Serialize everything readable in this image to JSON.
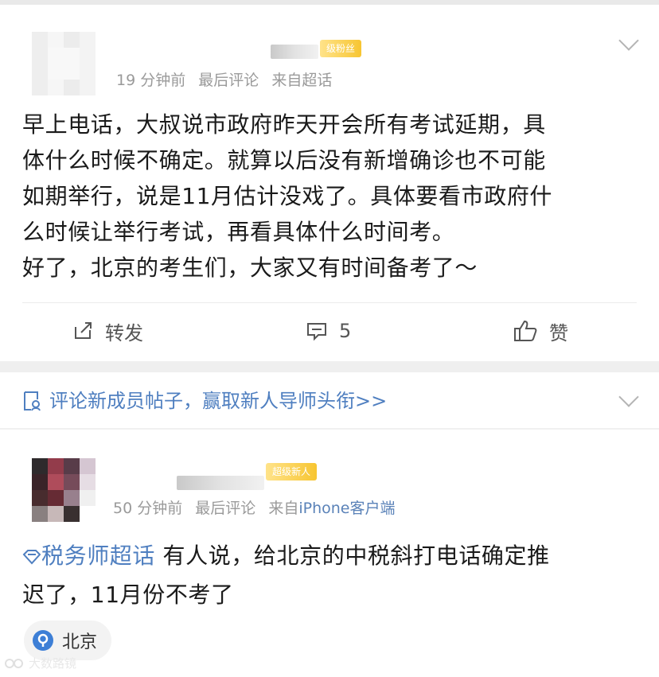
{
  "post1": {
    "level_badge": "级粉丝",
    "meta": {
      "time": "19 分钟前",
      "last_comment": "最后评论",
      "source": "来自超话"
    },
    "body": [
      "早上电话，大叔说市政府昨天开会所有考试延期，具",
      "体什么时候不确定。就算以后没有新增确诊也不可能",
      "如期举行，说是11月估计没戏了。具体要看市政府什",
      "么时候让举行考试，再看具体什么时间考。",
      "好了，北京的考生们，大家又有时间备考了～"
    ],
    "actions": {
      "repost_label": "转发",
      "comment_count": "5",
      "like_label": "赞"
    }
  },
  "banner": {
    "text": "评论新成员帖子，赢取新人导师头衔>>"
  },
  "post2": {
    "level_badge": "超级新人",
    "meta": {
      "time": "50 分钟前",
      "last_comment": "最后评论",
      "source_prefix": "来自",
      "source_client": "iPhone客户端"
    },
    "topic": "税务师超话",
    "body_line1": " 有人说，给北京的中税斜打电话确定推",
    "body_line2": "迟了，11月份不考了",
    "location": "北京"
  },
  "watermark": "大数路镜",
  "colors": {
    "accent_blue": "#4f7fc0",
    "meta_gray": "#9a9a9a",
    "badge_gold": "#f7c531"
  }
}
